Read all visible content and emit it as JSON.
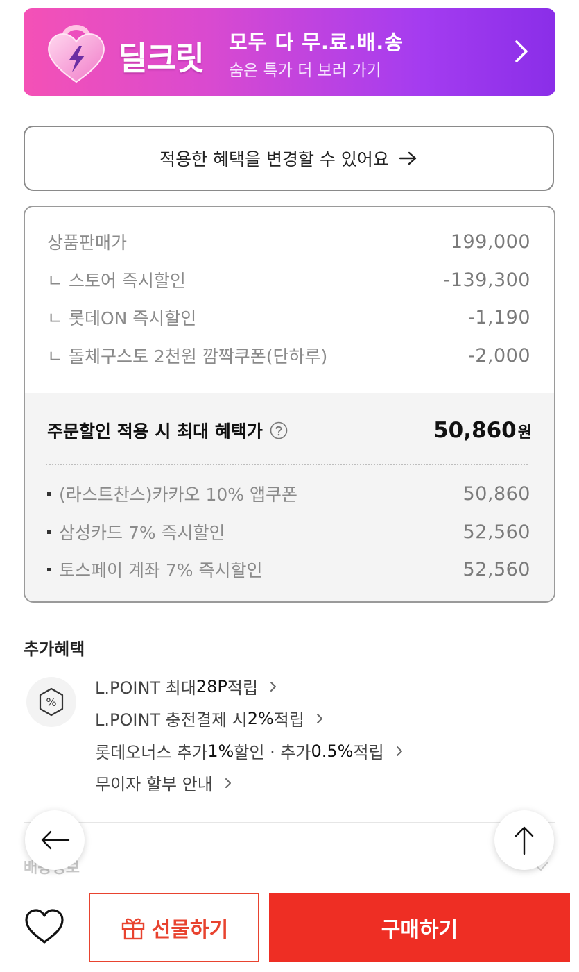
{
  "banner": {
    "logo_text": "딜크릿",
    "title": "모두 다 무.료.배.송",
    "subtitle": "숨은 특가 더 보러 가기"
  },
  "change_benefits": {
    "label": "적용한 혜택을 변경할 수 있어요"
  },
  "price": {
    "items": [
      {
        "label": "상품판매가",
        "value": "199,000"
      },
      {
        "label": "ㄴ 스토어 즉시할인",
        "value": "-139,300"
      },
      {
        "label": "ㄴ 롯데ON 즉시할인",
        "value": "-1,190"
      },
      {
        "label": "ㄴ 돌체구스토 2천원 깜짝쿠폰(단하루)",
        "value": "-2,000"
      }
    ],
    "max_label": "주문할인 적용 시 최대 혜택가",
    "max_value": "50,860",
    "max_unit": "원",
    "payment_options": [
      {
        "label": "(라스트찬스)카카오 10% 앱쿠폰",
        "value": "50,860"
      },
      {
        "label": "삼성카드 7% 즉시할인",
        "value": "52,560"
      },
      {
        "label": "토스페이 계좌 7% 즉시할인",
        "value": "52,560"
      }
    ]
  },
  "additional": {
    "title": "추가혜택",
    "badge": "%",
    "b1_pre": "L.POINT 최대 ",
    "b1_em": "28P",
    "b1_post": " 적립",
    "b2_pre": "L.POINT 충전결제 시 ",
    "b2_em": "2%",
    "b2_post": " 적립",
    "b3_pre": "롯데오너스 추가 ",
    "b3_em1": "1%",
    "b3_mid": " 할인 · 추가 ",
    "b3_em2": "0.5%",
    "b3_post": " 적립",
    "b4": "무이자 할부 안내"
  },
  "shipping": {
    "label": "배송정보"
  },
  "bottom": {
    "gift_label": "선물하기",
    "buy_label": "구매하기"
  },
  "colors": {
    "accent_red": "#ee2e24",
    "banner_start": "#f451b6",
    "banner_end": "#8a2ee8"
  }
}
